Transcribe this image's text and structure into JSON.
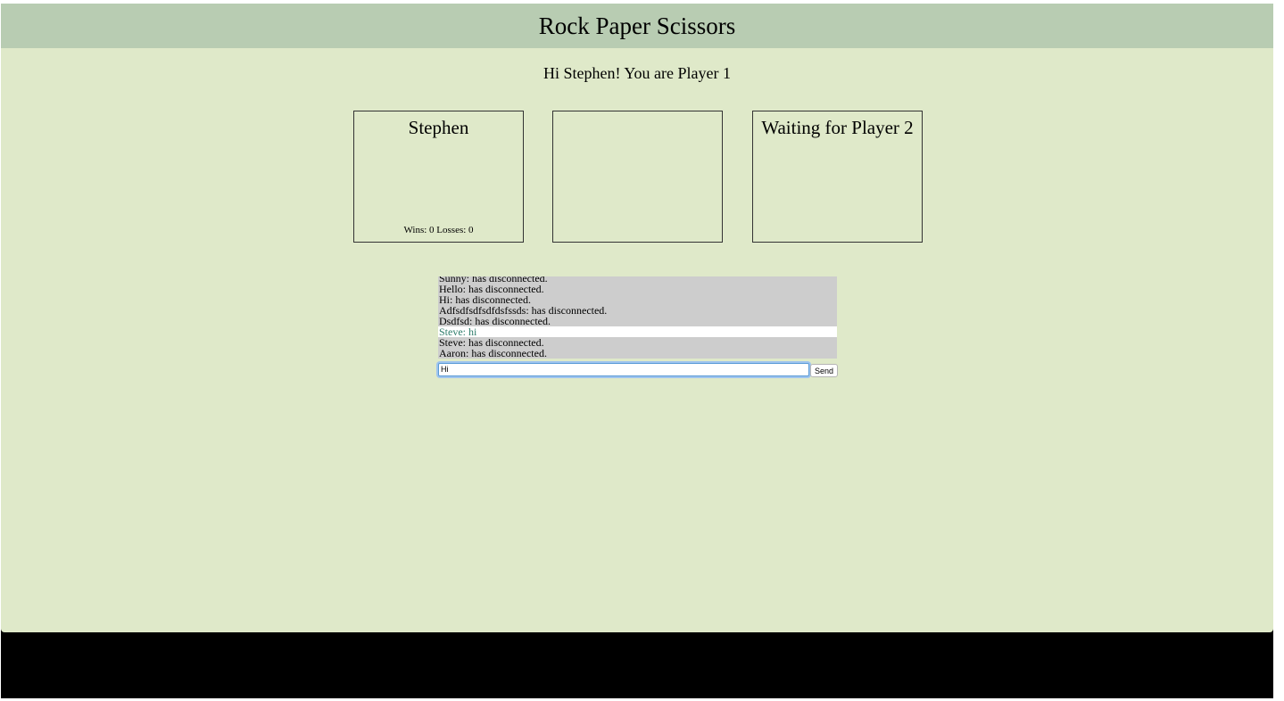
{
  "header": {
    "title": "Rock Paper Scissors"
  },
  "greeting": "Hi Stephen! You are Player 1",
  "panels": {
    "player1": {
      "name": "Stephen",
      "record": "Wins: 0 Losses: 0"
    },
    "result": {
      "text": ""
    },
    "player2": {
      "name": "Waiting for Player 2"
    }
  },
  "chat": {
    "messages": [
      {
        "text": "Sunny: has disconnected.",
        "kind": "system"
      },
      {
        "text": "Hello: has disconnected.",
        "kind": "system"
      },
      {
        "text": "Hi: has disconnected.",
        "kind": "system"
      },
      {
        "text": "Adfsdfsdfsdfdsfssds: has disconnected.",
        "kind": "system"
      },
      {
        "text": "Dsdfsd: has disconnected.",
        "kind": "system"
      },
      {
        "text": "Steve: hi",
        "kind": "msg"
      },
      {
        "text": "Steve: has disconnected.",
        "kind": "system"
      },
      {
        "text": "Aaron: has disconnected.",
        "kind": "system"
      }
    ],
    "input_value": "Hi",
    "send_label": "Send"
  },
  "colors": {
    "page_background": "#dfe9c9",
    "header_background": "#b8ccb2",
    "chat_background": "#cdcdcd",
    "chat_message_color": "#2e7d6b",
    "input_focus_border": "#5b9bd5"
  }
}
